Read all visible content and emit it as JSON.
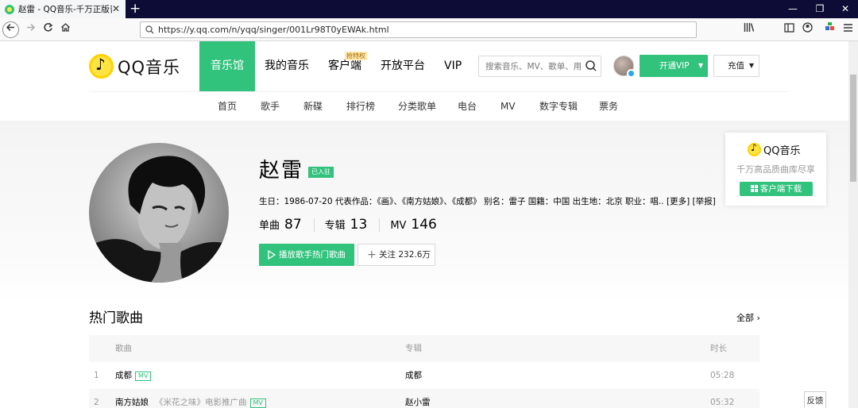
{
  "browser": {
    "tab_title": "赵雷 - QQ音乐-千万正版音乐",
    "tab_close": "✕",
    "new_tab": "+",
    "window": {
      "minimize": "—",
      "restore": "❐",
      "close": "✕"
    },
    "url": "https://y.qq.com/n/yqq/singer/001Lr98T0yEWAk.html"
  },
  "header": {
    "logo_text": "QQ音乐",
    "nav": [
      {
        "label": "音乐馆"
      },
      {
        "label": "我的音乐"
      },
      {
        "label": "客户端",
        "badge": "抢特权"
      },
      {
        "label": "开放平台"
      },
      {
        "label": "VIP"
      }
    ],
    "search_placeholder": "搜索音乐、MV、歌单、用户",
    "vip_button": "开通VIP",
    "recharge_button": "充值",
    "caret": "▼",
    "subnav": [
      "首页",
      "歌手",
      "新碟",
      "排行榜",
      "分类歌单",
      "电台",
      "MV",
      "数字专辑",
      "票务"
    ]
  },
  "singer": {
    "name": "赵雷",
    "verified": "已入驻",
    "info": "生日：1986-07-20 代表作品：《画》、《南方姑娘》、《成都》 别名：雷子 国籍：中国 出生地：北京 职业：唱.. [更多] [举报]",
    "stats": [
      {
        "label": "单曲",
        "value": "87"
      },
      {
        "label": "专辑",
        "value": "13"
      },
      {
        "label": "MV",
        "value": "146"
      }
    ],
    "play_button": "播放歌手热门歌曲",
    "follow_button": "关注 232.6万",
    "plus": "+"
  },
  "promo": {
    "logo_text": "QQ音乐",
    "slogan": "千万高品质曲库尽享",
    "button": "客户端下载"
  },
  "hot_songs": {
    "title": "热门歌曲",
    "all_link": "全部 ›",
    "columns": {
      "song": "歌曲",
      "album": "专辑",
      "duration": "时长"
    },
    "rows": [
      {
        "num": "1",
        "title": "成都",
        "sub": "",
        "mv": "MV",
        "album": "成都",
        "duration": "05:28"
      },
      {
        "num": "2",
        "title": "南方姑娘",
        "sub": "《米花之味》电影推广曲",
        "mv": "MV",
        "album": "赵小雷",
        "duration": "05:32"
      }
    ]
  },
  "feedback": "反馈",
  "colors": {
    "brand_green": "#31c27c",
    "logo_yellow": "#ffe443",
    "titlebar": "#0c0c36"
  }
}
